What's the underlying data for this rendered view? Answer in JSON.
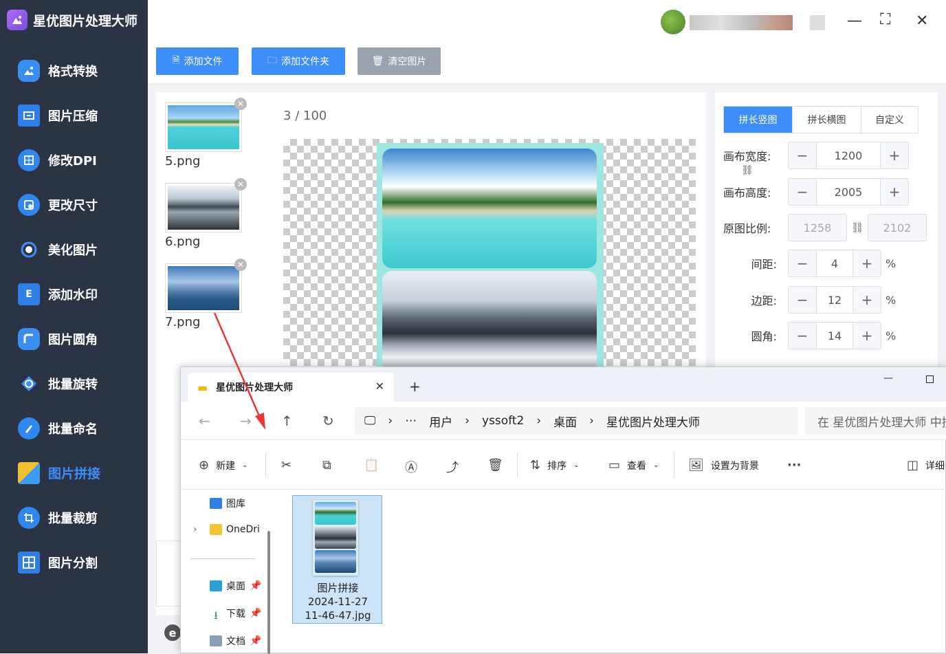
{
  "app": {
    "title": "星优图片处理大师"
  },
  "sidebar": {
    "items": [
      {
        "label": "格式转换"
      },
      {
        "label": "图片压缩"
      },
      {
        "label": "修改DPI"
      },
      {
        "label": "更改尺寸"
      },
      {
        "label": "美化图片"
      },
      {
        "label": "添加水印"
      },
      {
        "label": "图片圆角"
      },
      {
        "label": "批量旋转"
      },
      {
        "label": "批量命名"
      },
      {
        "label": "图片拼接",
        "active": true
      },
      {
        "label": "批量裁剪"
      },
      {
        "label": "图片分割"
      }
    ]
  },
  "toolbar": {
    "add_file": "添加文件",
    "add_folder": "添加文件夹",
    "clear": "清空图片"
  },
  "thumbnails": [
    {
      "name": "5.png"
    },
    {
      "name": "6.png"
    },
    {
      "name": "7.png"
    }
  ],
  "preview": {
    "page_current": "3",
    "page_sep": "/",
    "page_total": "100"
  },
  "settings": {
    "tabs": [
      "拼长竖图",
      "拼长横图",
      "自定义"
    ],
    "active_tab": "拼长竖图",
    "canvas_width_label": "画布宽度:",
    "canvas_width": "1200",
    "canvas_height_label": "画布高度:",
    "canvas_height": "2005",
    "ratio_label": "原图比例:",
    "ratio_w": "1258",
    "ratio_h": "2102",
    "gap_label": "间距:",
    "gap": "4",
    "margin_label": "边距:",
    "margin": "12",
    "radius_label": "圆角:",
    "radius": "14",
    "percent": "%"
  },
  "explorer": {
    "tab_title": "星优图片处理大师",
    "breadcrumb": [
      "用户",
      "yssoft2",
      "桌面",
      "星优图片处理大师"
    ],
    "search_placeholder": "在 星优图片处理大师 中搜索",
    "toolbar": {
      "new": "新建",
      "sort": "排序",
      "view": "查看",
      "set_bg": "设置为背景",
      "details": "详细"
    },
    "side": {
      "gallery": "图库",
      "onedrive": "OneDri",
      "desktop": "桌面",
      "downloads": "下载",
      "documents": "文档"
    },
    "file": {
      "line1": "图片拼接",
      "line2": "2024-11-27",
      "line3": "11-46-47.jpg"
    }
  },
  "colors": {
    "accent": "#3d8ef8",
    "sidebar_bg": "#2b3445",
    "arrow": "#e53935"
  }
}
